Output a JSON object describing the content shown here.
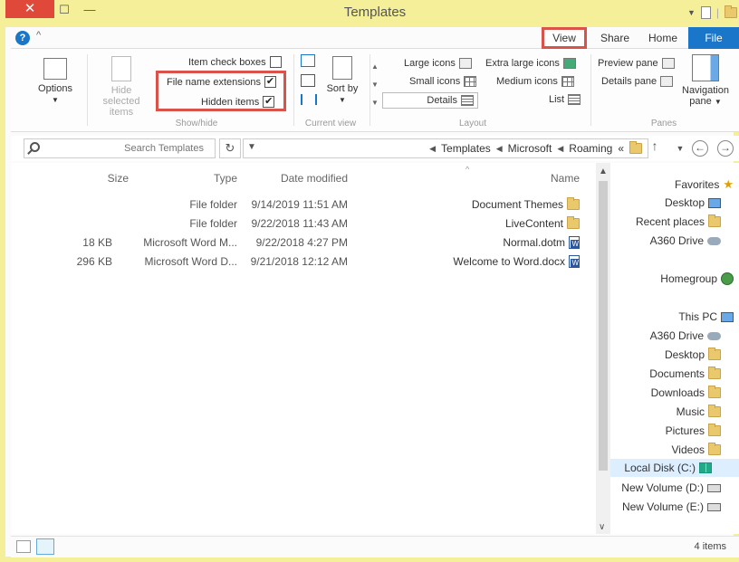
{
  "window": {
    "title": "Templates",
    "close": "✕",
    "maximize": "☐",
    "minimize": "—"
  },
  "tabs": {
    "file": "File",
    "home": "Home",
    "share": "Share",
    "view": "View"
  },
  "ribbon": {
    "panes": {
      "label": "Panes",
      "navigation_pane": "Navigation pane",
      "preview_pane": "Preview pane",
      "details_pane": "Details pane"
    },
    "layout": {
      "label": "Layout",
      "extra_large": "Extra large icons",
      "large": "Large icons",
      "medium": "Medium icons",
      "small": "Small icons",
      "list": "List",
      "details": "Details"
    },
    "current_view": {
      "label": "Current view",
      "sort_by": "Sort by"
    },
    "show_hide": {
      "label": "Show/hide",
      "item_check_boxes": "Item check boxes",
      "item_check_boxes_checked": false,
      "file_name_extensions": "File name extensions",
      "file_name_extensions_checked": true,
      "hidden_items": "Hidden items",
      "hidden_items_checked": true,
      "hide_selected_items": "Hide selected items"
    },
    "options": "Options"
  },
  "address": {
    "breadcrumb": [
      "«",
      "Roaming",
      "Microsoft",
      "Templates"
    ],
    "search_placeholder": "Search Templates"
  },
  "columns": {
    "name": "Name",
    "date_modified": "Date modified",
    "type": "Type",
    "size": "Size"
  },
  "files": [
    {
      "name": "Document Themes",
      "date": "9/14/2019 11:51 AM",
      "type": "File folder",
      "size": "",
      "kind": "folder"
    },
    {
      "name": "LiveContent",
      "date": "9/22/2018 11:43 AM",
      "type": "File folder",
      "size": "",
      "kind": "folder"
    },
    {
      "name": "Normal.dotm",
      "date": "9/22/2018 4:27 PM",
      "type": "Microsoft Word M...",
      "size": "18 KB",
      "kind": "word"
    },
    {
      "name": "Welcome to Word.docx",
      "date": "9/21/2018 12:12 AM",
      "type": "Microsoft Word D...",
      "size": "296 KB",
      "kind": "word"
    }
  ],
  "nav": {
    "favorites": "Favorites",
    "desktop": "Desktop",
    "recent_places": "Recent places",
    "a360_fav": "A360 Drive",
    "homegroup": "Homegroup",
    "this_pc": "This PC",
    "a360": "A360 Drive",
    "pc_desktop": "Desktop",
    "documents": "Documents",
    "downloads": "Downloads",
    "music": "Music",
    "pictures": "Pictures",
    "videos": "Videos",
    "local_disk": "Local Disk (C:)",
    "volume_d": "New Volume (D:)",
    "volume_e": "New Volume (E:)"
  },
  "status": {
    "item_count": "4 items"
  }
}
